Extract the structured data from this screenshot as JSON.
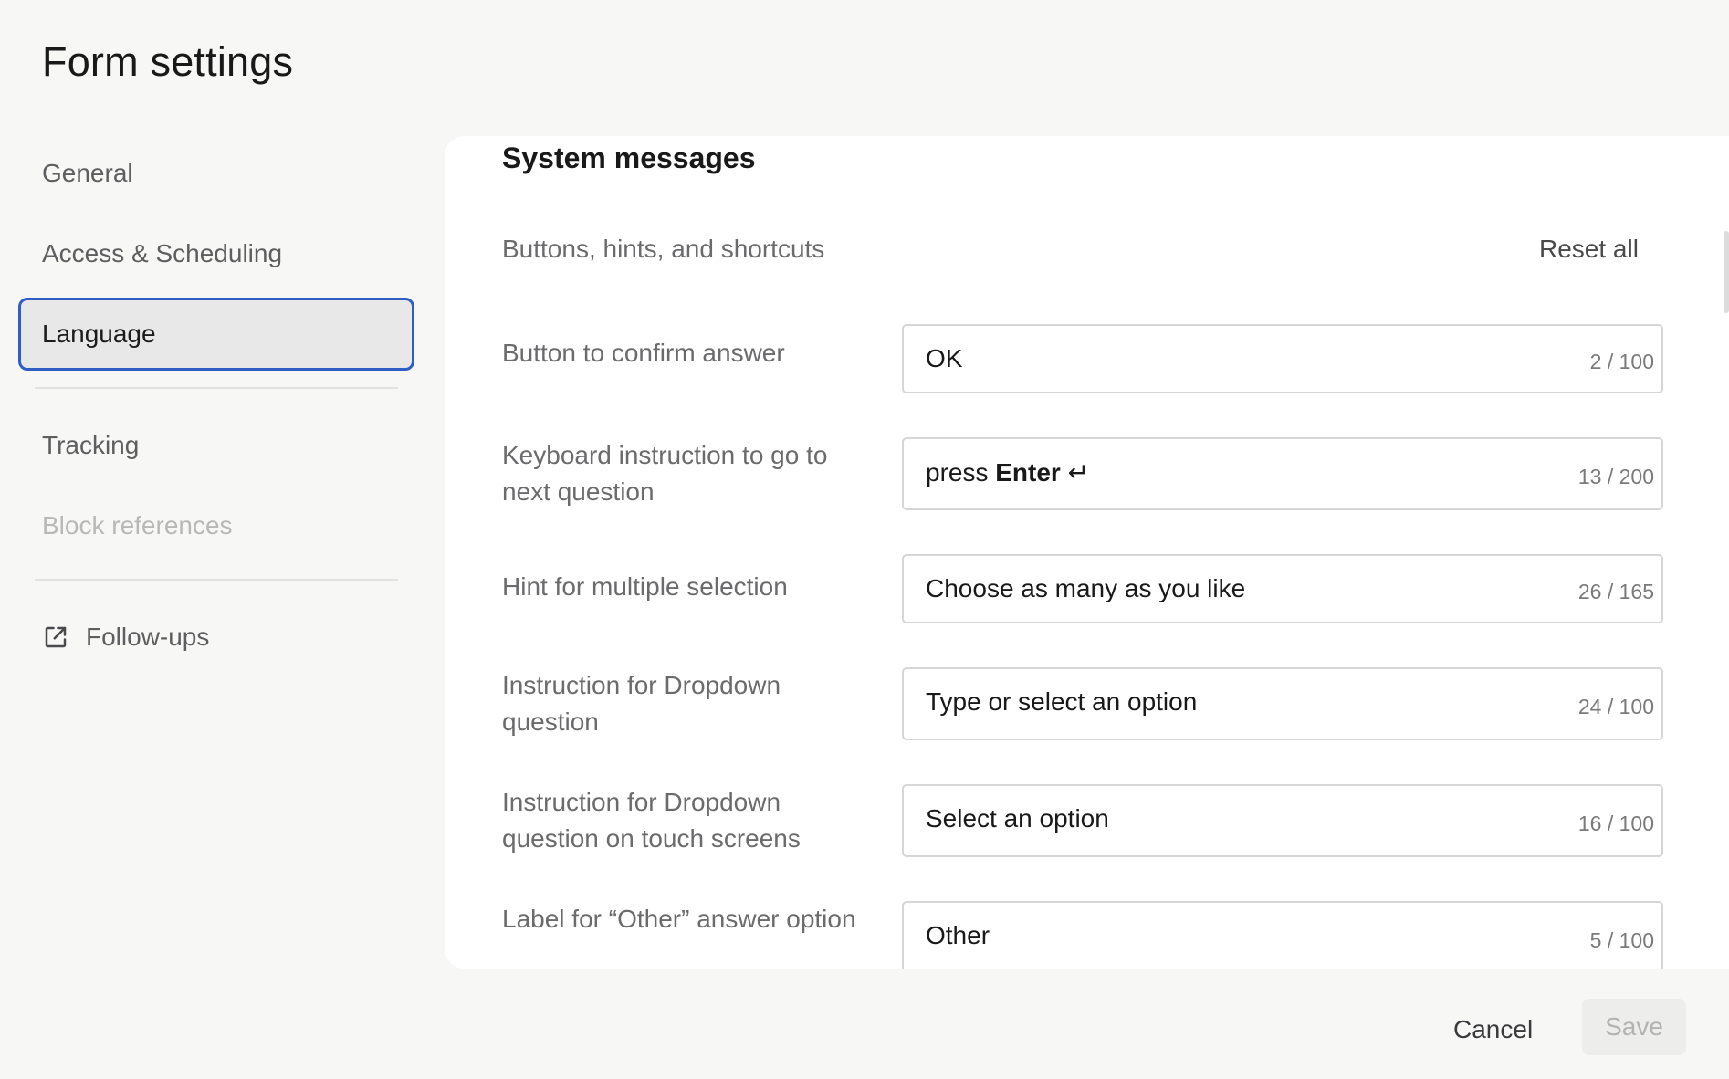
{
  "page": {
    "title": "Form settings"
  },
  "sidebar": {
    "items": [
      {
        "label": "General"
      },
      {
        "label": "Access & Scheduling"
      },
      {
        "label": "Language"
      },
      {
        "label": "Tracking"
      },
      {
        "label": "Block references"
      },
      {
        "label": "Follow-ups",
        "icon": "external-link-icon"
      }
    ],
    "active_index": 2
  },
  "main": {
    "section_title": "System messages",
    "subsection": "Buttons, hints, and shortcuts",
    "reset_all": "Reset all",
    "rows": [
      {
        "label": "Button to confirm answer",
        "value": "OK",
        "count": "2 / 100"
      },
      {
        "label": "Keyboard instruction to go to next question",
        "value_prefix": "press ",
        "value_bold": "Enter",
        "value_suffix": " ↵",
        "count": "13 / 200"
      },
      {
        "label": "Hint for multiple selection",
        "value": "Choose as many as you like",
        "count": "26 / 165"
      },
      {
        "label": "Instruction for Dropdown question",
        "value": "Type or select an option",
        "count": "24 / 100"
      },
      {
        "label": "Instruction for Dropdown question on touch screens",
        "value": "Select an option",
        "count": "16 / 100"
      },
      {
        "label": "Label for “Other” answer option",
        "value": "Other",
        "count": "5 / 100"
      }
    ]
  },
  "footer": {
    "cancel": "Cancel",
    "save": "Save"
  },
  "colors": {
    "accent": "#2f5fc4",
    "background": "#f7f7f6",
    "card": "#ffffff"
  }
}
